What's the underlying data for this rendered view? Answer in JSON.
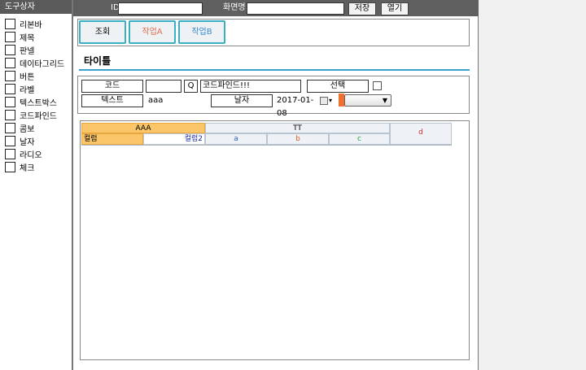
{
  "toolbox": {
    "title": "도구상자",
    "items": [
      "리본바",
      "제목",
      "판넬",
      "데이타그리드",
      "버튼",
      "라벨",
      "텍스트박스",
      "코드파인드",
      "콤보",
      "날자",
      "라디오",
      "체크"
    ]
  },
  "topbar": {
    "id_label": "ID",
    "id_value": "",
    "screen_label": "화면명",
    "screen_value": "",
    "save_label": "저장",
    "open_label": "열기"
  },
  "ribbon": {
    "buttons": [
      {
        "label": "조회",
        "color": "#000000"
      },
      {
        "label": "작업A",
        "color": "#e07050"
      },
      {
        "label": "작업B",
        "color": "#3a8cd0"
      }
    ]
  },
  "title": "타이틀",
  "search": {
    "code_label": "코드",
    "code_value": "",
    "find_button": "Q",
    "codefind_text": "코드파인드!!!",
    "select_label": "선택",
    "text_label": "텍스트",
    "text_value": "aaa",
    "date_label": "날자",
    "date_value": "2017-01-08",
    "combo_value": ""
  },
  "grid": {
    "header_aaa": "AAA",
    "header_tt": "TT",
    "header_d": "d",
    "col1": "컬럼",
    "col2": "컬럼2",
    "sub_a": "a",
    "sub_b": "b",
    "sub_c": "c",
    "colors": {
      "aaa_bg": "#fbc56a",
      "d": "#d03030",
      "col2": "#1a2aa0",
      "a": "#3060c0",
      "b": "#e06030",
      "c": "#2a9a3a"
    }
  }
}
